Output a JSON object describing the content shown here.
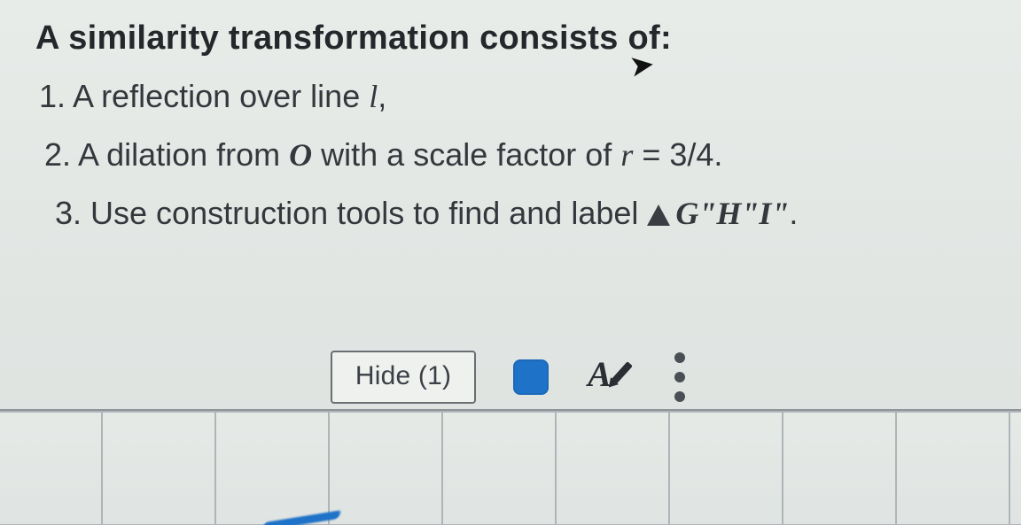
{
  "heading": "A similarity transformation consists of:",
  "step1_prefix": "1. A reflection over line ",
  "step1_var": "l",
  "step1_suffix": ",",
  "step2_prefix": "2. A dilation from ",
  "step2_center": "O",
  "step2_mid": " with a scale factor of ",
  "step2_var": "r",
  "step2_eq": " = 3/4.",
  "step3_prefix": "3. Use construction tools to find and label ",
  "step3_triangle": "G\"H\"I\"",
  "step3_suffix": ".",
  "toolbar": {
    "hide_label": "Hide (1)"
  }
}
